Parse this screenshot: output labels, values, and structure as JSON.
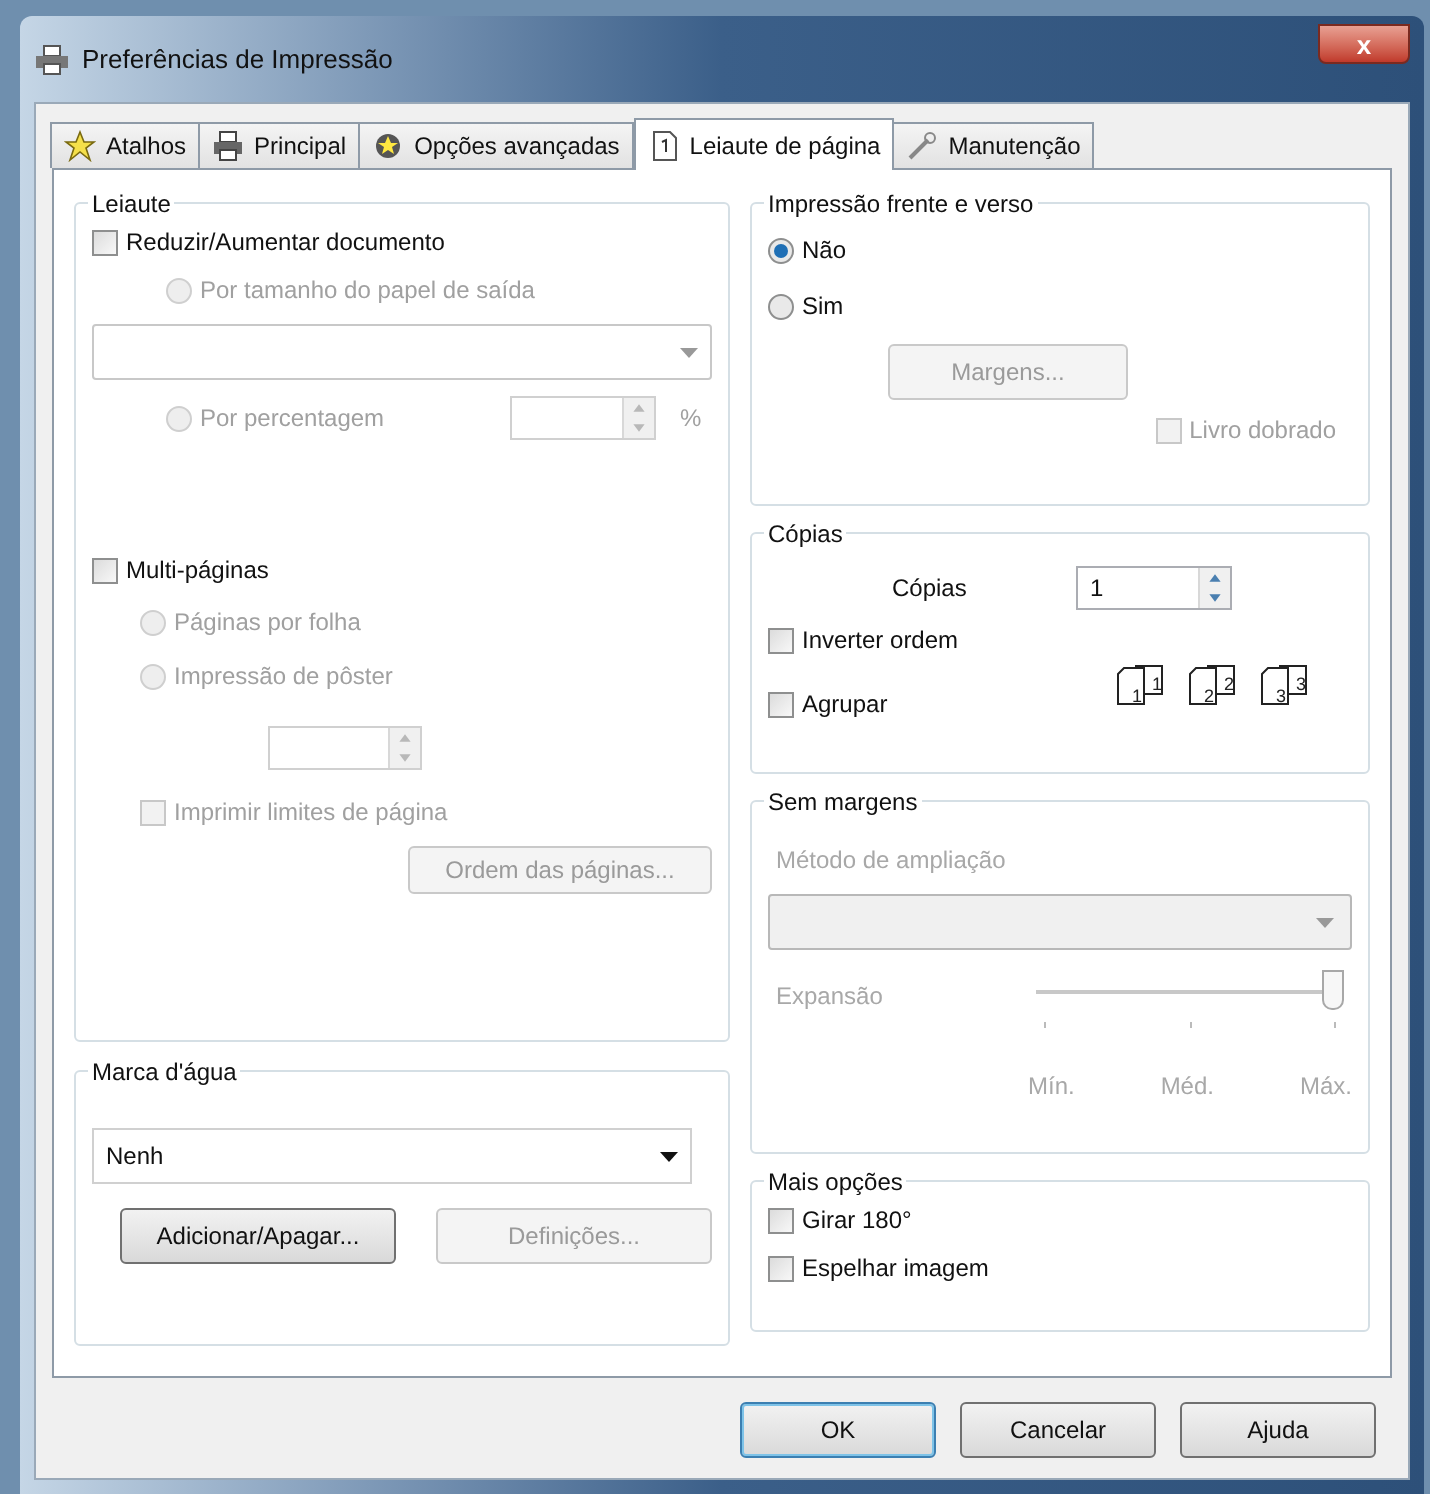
{
  "window": {
    "title": "Preferências de Impressão",
    "close": "x"
  },
  "tabs": [
    {
      "label": "Atalhos",
      "selected": false
    },
    {
      "label": "Principal",
      "selected": false
    },
    {
      "label": "Opções avançadas",
      "selected": false
    },
    {
      "label": "Leiaute de página",
      "selected": true
    },
    {
      "label": "Manutenção",
      "selected": false
    }
  ],
  "layout": {
    "title": "Leiaute",
    "resize": {
      "label": "Reduzir/Aumentar documento",
      "checked": false,
      "disabled": false
    },
    "by_paper": {
      "label": "Por tamanho do papel de saída",
      "selected": false,
      "disabled": true
    },
    "by_percent": {
      "label": "Por percentagem",
      "selected": false,
      "disabled": true
    },
    "percent_unit": "%",
    "multipage": {
      "label": "Multi-páginas",
      "checked": false,
      "disabled": false
    },
    "pages_per_sheet": {
      "label": "Páginas por folha",
      "selected": false,
      "disabled": true
    },
    "poster": {
      "label": "Impressão de pôster",
      "selected": false,
      "disabled": true
    },
    "print_borders": {
      "label": "Imprimir limites de página",
      "checked": false,
      "disabled": true
    },
    "page_order_button": {
      "label": "Ordem das páginas...",
      "disabled": true
    }
  },
  "watermark": {
    "title": "Marca d'água",
    "value": "Nenh",
    "buttons": [
      {
        "label": "Adicionar/Apagar...",
        "disabled": false
      },
      {
        "label": "Definições...",
        "disabled": true
      }
    ]
  },
  "duplex": {
    "title": "Impressão frente e verso",
    "options": [
      {
        "label": "Não",
        "selected": true
      },
      {
        "label": "Sim",
        "selected": false
      }
    ],
    "margins_button": {
      "label": "Margens...",
      "disabled": true
    },
    "booklet": {
      "label": "Livro dobrado",
      "checked": false,
      "disabled": true
    }
  },
  "copies": {
    "title": "Cópias",
    "label": "Cópias",
    "value": "1",
    "reverse": {
      "label": "Inverter ordem",
      "checked": false,
      "disabled": false
    },
    "collate": {
      "label": "Agrupar",
      "checked": false,
      "disabled": false
    },
    "collate_icons": [
      {
        "back": "1",
        "front": "1"
      },
      {
        "back": "2",
        "front": "2"
      },
      {
        "back": "3",
        "front": "3"
      }
    ]
  },
  "borderless": {
    "title": "Sem margens",
    "method_label": "Método de ampliação",
    "expansion": {
      "label": "Expansão",
      "level": 1,
      "ticks": [
        "Mín.",
        "Méd.",
        "Máx."
      ]
    }
  },
  "more": {
    "title": "Mais opções",
    "options": [
      {
        "label": "Girar 180°",
        "checked": false,
        "disabled": false
      },
      {
        "label": "Espelhar imagem",
        "checked": false,
        "disabled": false
      }
    ]
  },
  "buttons": [
    {
      "label": "OK",
      "default": true
    },
    {
      "label": "Cancelar",
      "default": false
    },
    {
      "label": "Ajuda",
      "default": false
    }
  ]
}
